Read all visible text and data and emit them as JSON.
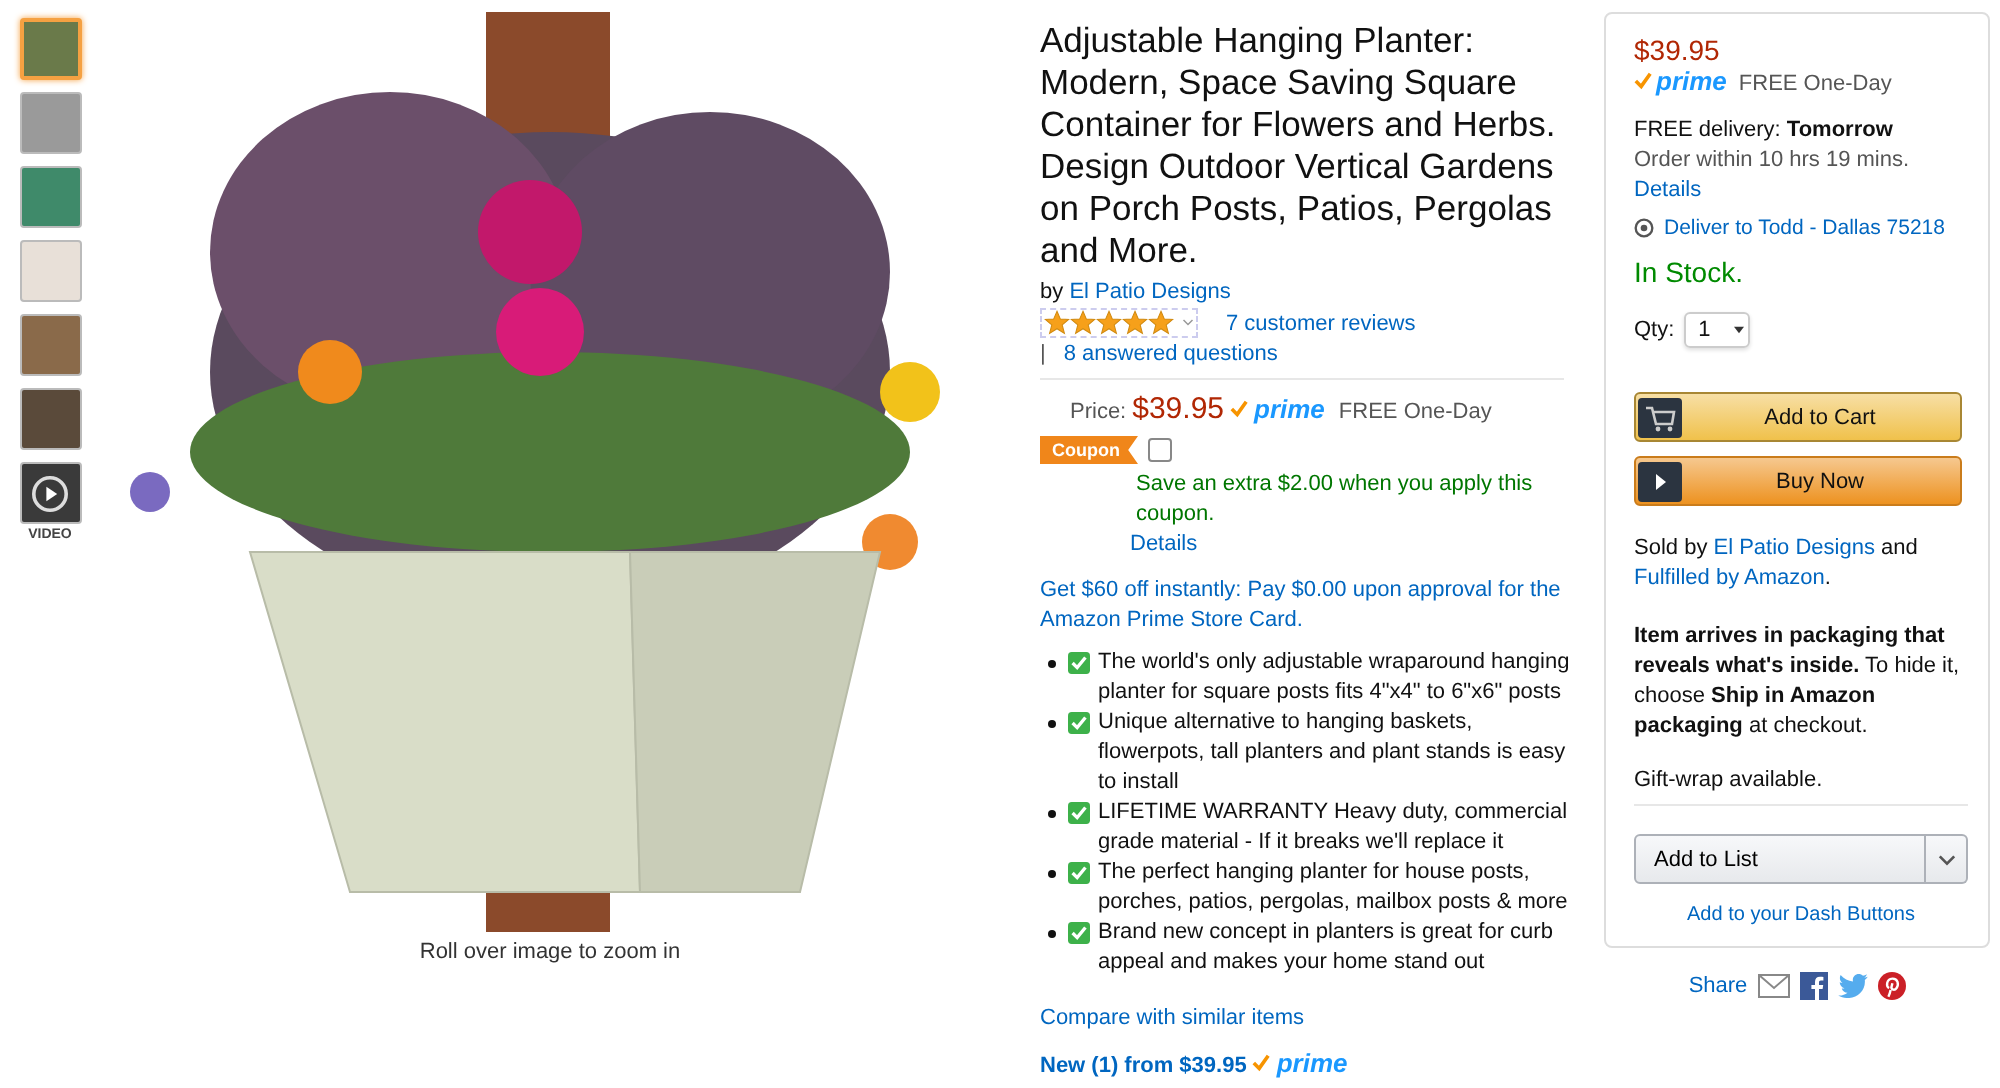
{
  "gallery": {
    "thumbnails": [
      {
        "kind": "image",
        "selected": true
      },
      {
        "kind": "image",
        "selected": false
      },
      {
        "kind": "image",
        "selected": false
      },
      {
        "kind": "image",
        "selected": false
      },
      {
        "kind": "image",
        "selected": false
      },
      {
        "kind": "image",
        "selected": false
      },
      {
        "kind": "video",
        "selected": false,
        "label": "VIDEO"
      }
    ],
    "zoom_hint": "Roll over image to zoom in"
  },
  "product": {
    "title": "Adjustable Hanging Planter: Modern, Space Saving Square Container for Flowers and Herbs. Design Outdoor Vertical Gardens on Porch Posts, Patios, Pergolas and More.",
    "by": "by",
    "brand": "El Patio Designs",
    "stars": 5,
    "reviews": "7 customer reviews",
    "separator": "|",
    "questions": "8 answered questions",
    "price_label": "Price:",
    "price": "$39.95",
    "prime": "prime",
    "shipping": "FREE One-Day",
    "coupon": {
      "badge": "Coupon",
      "checked": false,
      "text": "Save an extra $2.00 when you apply this coupon.",
      "details": "Details"
    },
    "card_offer": "Get $60 off instantly: Pay $0.00 upon approval for the Amazon Prime Store Card.",
    "bullets": [
      "The world's only adjustable wraparound hanging planter for square posts fits 4\"x4\" to 6\"x6\" posts",
      "Unique alternative to hanging baskets, flowerpots, tall planters and plant stands is easy to install",
      "LIFETIME WARRANTY Heavy duty, commercial grade material - If it breaks we'll replace it",
      "The perfect hanging planter for house posts, porches, patios, pergolas, mailbox posts & more",
      "Brand new concept in planters is great for curb appeal and makes your home stand out"
    ],
    "compare": "Compare with similar items",
    "new_offer": "New (1) from $39.95",
    "new_prime": "prime"
  },
  "buy_box": {
    "price": "$39.95",
    "prime": "prime",
    "shipping": "FREE One-Day",
    "delivery": "FREE delivery: **Tomorrow**",
    "order_within": "Order within 10 hrs 19 mins.",
    "details": "Details",
    "deliver_to": "Deliver to Todd - Dallas 75218",
    "stock": "In Stock.",
    "qty_label": "Qty:",
    "qty": "1",
    "add_to_cart": "Add to Cart",
    "buy_now": "Buy Now",
    "sold_by": [
      {
        "kind": "text",
        "text": "Sold by "
      },
      {
        "kind": "link",
        "text": "El Patio Designs"
      },
      {
        "kind": "text",
        "text": " and "
      },
      {
        "kind": "link",
        "text": "Fulfilled by Amazon"
      },
      {
        "kind": "text",
        "text": "."
      }
    ],
    "packaging": "**Item arrives in packaging that reveals what's inside.** To hide it, choose **Ship in Amazon packaging** at checkout.",
    "gift_wrap": "Gift-wrap available.",
    "add_to_list": "Add to List",
    "dash": "Add to your Dash Buttons"
  },
  "share": {
    "label": "Share"
  }
}
